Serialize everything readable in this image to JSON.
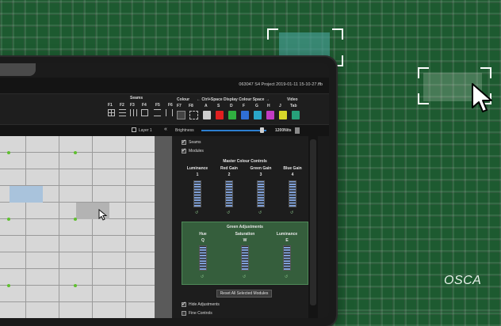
{
  "background": {
    "watermark": "OSCA",
    "colors": {
      "plaid": "#1d5a30",
      "selection_fill": "#46a096"
    }
  },
  "titlebar": {
    "project_title": "063047  S4 Project 2019-01-11 15-10-27.ffb"
  },
  "toolbar": {
    "seams": {
      "heading": "Seams",
      "keys": [
        "F1",
        "F2",
        "F3",
        "F4",
        "F5",
        "F6"
      ]
    },
    "colour": {
      "heading": "Colour",
      "keys": [
        "F7",
        "F8"
      ]
    },
    "ctrl_space": {
      "heading": "← Ctrl+Space Display Colour Space →",
      "keys": [
        "A",
        "S",
        "D",
        "F",
        "G",
        "H",
        "J"
      ]
    },
    "video": {
      "heading": "Video",
      "key": "Tab"
    },
    "swatches": [
      "#cfcfcf",
      "#e02020",
      "#30b040",
      "#2f6fd6",
      "#2aa7c9",
      "#c23cc2",
      "#d8d82a",
      "#27a07a"
    ]
  },
  "layerbar": {
    "layer_label": "Layer 1",
    "prev_icon": "double-chevron-left-icon",
    "brightness_label": "Brightness",
    "brightness_value": "1200Nits",
    "brightness_level": 0.93
  },
  "panel": {
    "seams_label": "Seams",
    "modules_label": "Modules",
    "master_title": "Master Colour Controls",
    "master_faders": [
      {
        "label": "Luminance",
        "key": "1"
      },
      {
        "label": "Red Gain",
        "key": "2"
      },
      {
        "label": "Green Gain",
        "key": "3"
      },
      {
        "label": "Blue Gain",
        "key": "4"
      }
    ],
    "green_title": "Green Adjustments",
    "green_faders": [
      {
        "label": "Hue",
        "key": "Q"
      },
      {
        "label": "Saturation",
        "key": "W"
      },
      {
        "label": "Luminance",
        "key": "E"
      }
    ],
    "link_icon": "↺",
    "reset_label": "Reset All Selected Modules",
    "hide_adjustments_label": "Hide Adjustments",
    "fine_controls_label": "Fine Controls"
  }
}
